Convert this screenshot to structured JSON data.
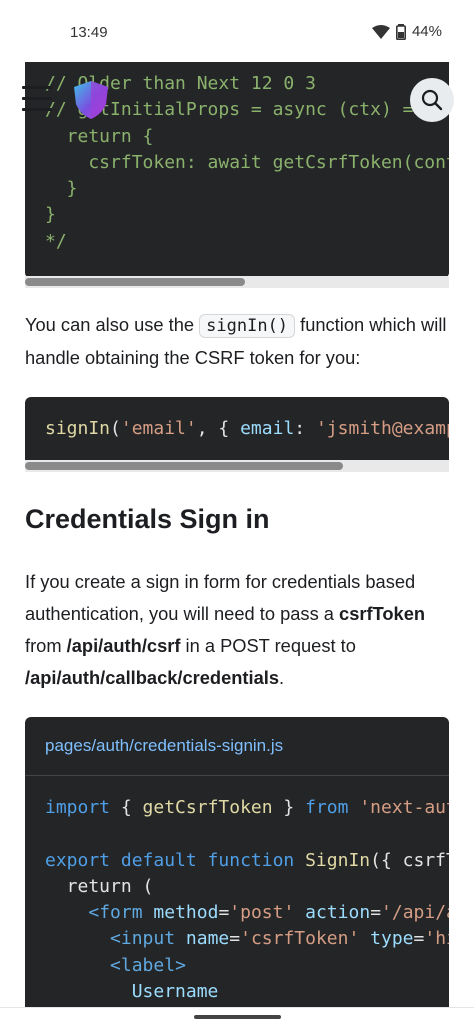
{
  "status_bar": {
    "time": "13:49",
    "battery": "44%"
  },
  "navbar": {
    "logo_icon": "shield-logo-icon",
    "menu_icon": "hamburger-menu-icon",
    "search_icon": "search-icon"
  },
  "code_block_1": {
    "lines": [
      "// Older than Next 12 0 3",
      "// getInitialProps = async (ctx) => {",
      "  return {",
      "    csrfToken: await getCsrfToken(context)",
      "  }",
      "}",
      "*/"
    ],
    "scroll_fraction": 0.52
  },
  "paragraph_1": {
    "before": "You can also use the ",
    "code": "signIn()",
    "after": " function which will handle obtaining the CSRF token for you:"
  },
  "code_block_2": {
    "fn": "signIn",
    "arg1": "'email'",
    "mid": ", { ",
    "key": "email",
    "colon": ": ",
    "val": "'jsmith@example.com'",
    "scroll_fraction": 0.75
  },
  "heading": "Credentials Sign in",
  "paragraph_2": {
    "t1": "If you create a sign in form for credentials based authentication, you will need to pass a ",
    "b1": "csrfToken",
    "t2": " from ",
    "b2": "/api/auth/csrf",
    "t3": " in a POST request to ",
    "b3": "/api/auth/callback/credentials",
    "t4": "."
  },
  "code_block_3": {
    "filename": "pages/auth/credentials-signin.js",
    "l1": {
      "kw": "import",
      "a": " { ",
      "fn": "getCsrfToken",
      "b": " } ",
      "kw2": "from",
      "c": " ",
      "st": "'next-auth/react'"
    },
    "l2": {
      "kw": "export default function",
      "c": " ",
      "fn": "SignIn",
      "a": "({ csrfToken }) {"
    },
    "l3": "  return (",
    "l4": {
      "ind": "    ",
      "lt": "<",
      "tag": "form",
      "sp": " ",
      "attr": "method",
      "eq": "=",
      "st": "'post'",
      "sp2": " ",
      "attr2": "action",
      "eq2": "=",
      "st2": "'/api/auth/callback/credentials'"
    },
    "l5": {
      "ind": "      ",
      "lt": "<",
      "tag": "input",
      "sp": " ",
      "attr": "name",
      "eq": "=",
      "st": "'csrfToken'",
      "sp2": " ",
      "attr2": "type",
      "eq2": "=",
      "st2": "'hidden'"
    },
    "l6": {
      "ind": "      ",
      "lt": "<",
      "tag": "label",
      "gt": ">"
    },
    "l7": {
      "ind": "        ",
      "text": "Username"
    }
  }
}
